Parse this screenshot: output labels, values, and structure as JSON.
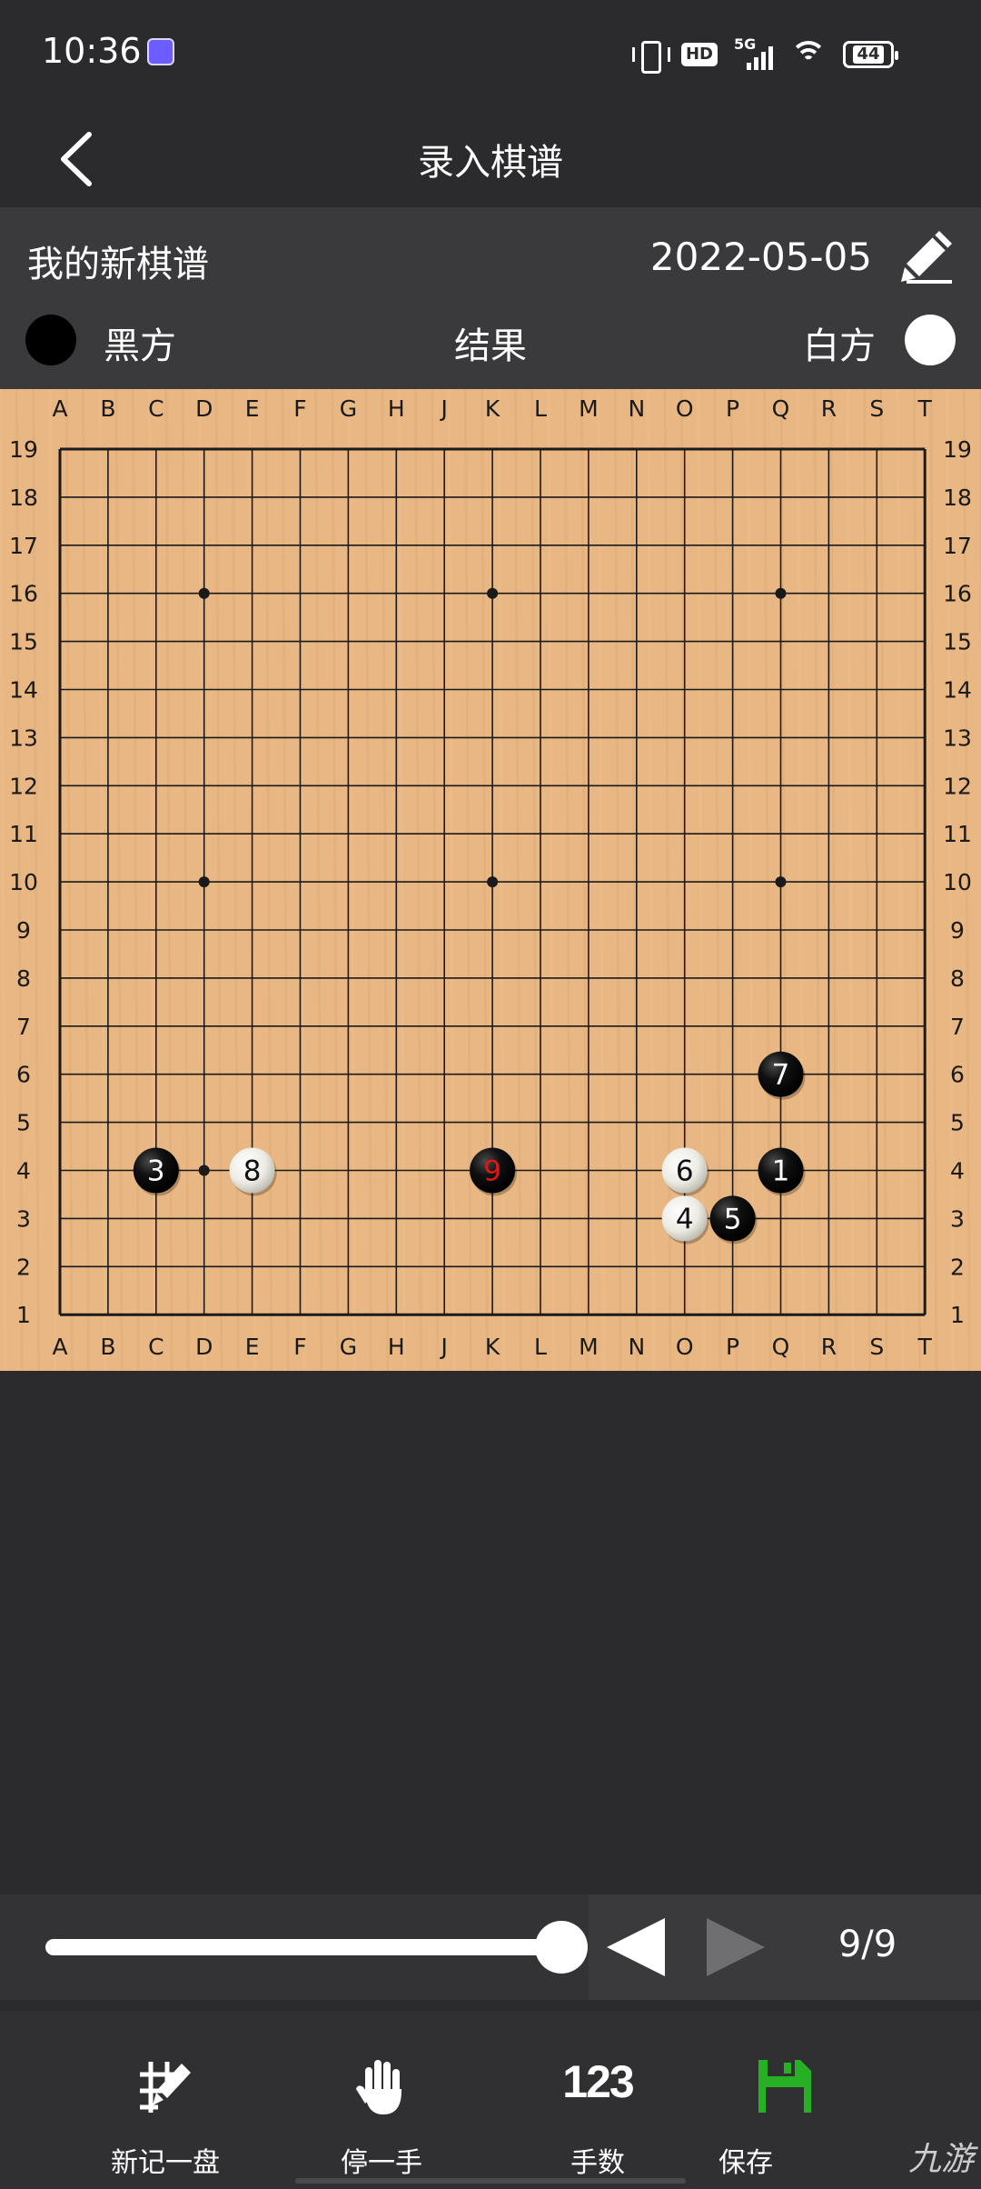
{
  "status_bar": {
    "time": "10:36",
    "hd": "HD",
    "network": "5G",
    "battery": "44"
  },
  "header": {
    "title": "录入棋谱",
    "back_icon": "chevron-left-icon"
  },
  "record": {
    "name": "我的新棋谱",
    "date": "2022-05-05",
    "edit_icon": "pencil-icon",
    "black_label": "黑方",
    "result_label": "结果",
    "white_label": "白方"
  },
  "board": {
    "size": 19,
    "columns": [
      "A",
      "B",
      "C",
      "D",
      "E",
      "F",
      "G",
      "H",
      "J",
      "K",
      "L",
      "M",
      "N",
      "O",
      "P",
      "Q",
      "R",
      "S",
      "T"
    ],
    "rows": [
      "19",
      "18",
      "17",
      "16",
      "15",
      "14",
      "13",
      "12",
      "11",
      "10",
      "9",
      "8",
      "7",
      "6",
      "5",
      "4",
      "3",
      "2",
      "1"
    ],
    "star_points": [
      "D16",
      "K16",
      "Q16",
      "D10",
      "K10",
      "Q10",
      "D4",
      "K4",
      "Q4"
    ],
    "stones": [
      {
        "number": "1",
        "color": "black",
        "point": "Q4"
      },
      {
        "number": "3",
        "color": "black",
        "point": "C4"
      },
      {
        "number": "4",
        "color": "white",
        "point": "O3"
      },
      {
        "number": "5",
        "color": "black",
        "point": "P3"
      },
      {
        "number": "6",
        "color": "white",
        "point": "O4"
      },
      {
        "number": "7",
        "color": "black",
        "point": "Q6"
      },
      {
        "number": "8",
        "color": "white",
        "point": "E4"
      },
      {
        "number": "9",
        "color": "black",
        "point": "K4",
        "last_move": true
      }
    ],
    "colors": {
      "wood": "#e8b783",
      "line": "#1a1a1a",
      "last_move_number": "#e01515"
    }
  },
  "controls": {
    "progress": 1.0,
    "prev_icon": "triangle-left-icon",
    "next_icon": "triangle-right-icon",
    "move_counter": "9/9"
  },
  "toolbar": {
    "new_record": {
      "label": "新记一盘",
      "icon": "new-board-pencil-icon"
    },
    "pass": {
      "label": "停一手",
      "icon": "hand-icon"
    },
    "move_numbers": {
      "label": "手数",
      "icon_text": "123"
    },
    "save": {
      "label": "保存",
      "icon": "floppy-disk-icon"
    }
  },
  "watermark": "九游"
}
